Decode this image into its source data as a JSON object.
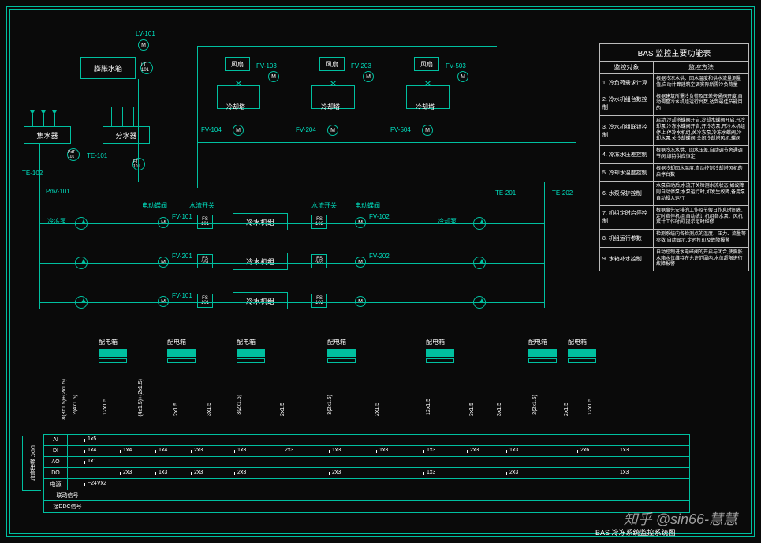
{
  "title_caption": "BAS 冷冻系统监控系统图",
  "watermark": "知乎 @sin66-慧慧",
  "tags": {
    "lv101": "LV-101",
    "lt101": "LT 101",
    "expansion_tank": "膨胀水箱",
    "collector": "集水器",
    "distributor": "分水器",
    "pdt101": "PdT 101",
    "te101": "TE-101",
    "te102": "TE-102",
    "ft101": "FT 101",
    "pdv101": "PdV-101",
    "te201": "TE-201",
    "te202": "TE-202",
    "fv103": "FV-103",
    "fv203": "FV-203",
    "fv503": "FV-503",
    "fv104": "FV-104",
    "fv204": "FV-204",
    "fv504": "FV-504",
    "fv101": "FV-101",
    "fv102": "FV-102",
    "fv201": "FV-201",
    "fv202": "FV-202",
    "fv301r": "FV-101",
    "fan": "风扇",
    "cooling_tower": "冷却塔",
    "chiller": "冷水机组",
    "freeze_pump_label": "冷冻泵",
    "cooling_pump_label": "冷却泵",
    "ddv_label_motor": "电动蝶阀",
    "ddv_label_flow": "水流开关",
    "fs101": "FS 101",
    "fs201": "FS 201",
    "fs301": "FS 101",
    "fs102": "FS 102",
    "fs202": "FS 202",
    "fs302": "FS 102",
    "m": "M",
    "dist_box": "配电箱"
  },
  "function_table": {
    "title": "BAS 监控主要功能表",
    "head1": "监控对象",
    "head2": "监控方法",
    "rows": [
      {
        "c1": "1. 冷负荷需求计算",
        "c2": "根据冷冻水供、回水温度和供水流量测量值,自动计算建筑空调实际所需冷负荷量"
      },
      {
        "c1": "2. 冷水机组台数控制",
        "c2": "根据建筑所需冷负荷及压差旁通阀开度,自动调整冷水机组运行台数,达到最佳节能目的"
      },
      {
        "c1": "3. 冷水机组联锁控制",
        "c2": "启动:冷却塔蝶阀开启,冷却水蝶阀开启,开冷却泵;冷冻水蝶阀开启,开冷冻泵,开冷水机组\n停止:停冷水机组,关冷冻泵,冷冻水蝶阀,冷却水泵,关冷却蝶阀,关闭冷却塔风机,蝶阀"
      },
      {
        "c1": "4. 冷冻水压差控制",
        "c2": "根据冷冻水供、回水压差,自动调节旁通调节阀,维持供应恒定"
      },
      {
        "c1": "5. 冷却水温度控制",
        "c2": "根据冷却回水温度,自动控制冷却塔风机的启停台数"
      },
      {
        "c1": "6. 水泵保护控制",
        "c2": "水泵启动后,水流开关检测水流状态,如故障则自动停泵;水泵运行时,如发生故障,备用泵自动投入运行"
      },
      {
        "c1": "7. 机组定时启停控制",
        "c2": "根据事先安排的工作及节假日作息时间表,定时启停机组;自动统计机组各水泵、风机累计工作时间,提示定时维修"
      },
      {
        "c1": "8. 机组运行参数",
        "c2": "检测系统内各检测点的温度、压力、流量等参数\n自动显示,定时打印及故障报警"
      },
      {
        "c1": "9. 水箱补水控制",
        "c2": "自动控制进水电磁阀的开启与闭合,使膨胀水箱水位维持在允许范围内,水位超限进行故障报警"
      }
    ]
  },
  "ddc": {
    "side": "DDC 输出信号",
    "rows": [
      {
        "label": "AI",
        "vals": [
          "1x5",
          "",
          "",
          "",
          "",
          "",
          "",
          "",
          ""
        ]
      },
      {
        "label": "DI",
        "vals": [
          "1x4",
          "1x4",
          "1x4",
          "2x3",
          "1x3",
          "2x3",
          "1x3",
          "1x3",
          "1x3",
          "2x3",
          "1x3",
          "",
          "2x6",
          "1x3"
        ]
      },
      {
        "label": "AO",
        "vals": [
          "1x1",
          "",
          "",
          "",
          "",
          "",
          "",
          "",
          "",
          "",
          "",
          "",
          "",
          ""
        ]
      },
      {
        "label": "DO",
        "vals": [
          "",
          "2x3",
          "1x3",
          "2x3",
          "2x3",
          "",
          "2x3",
          "",
          "1x3",
          "",
          "2x3",
          "",
          "",
          "1x3"
        ]
      },
      {
        "label": "电源",
        "vals": [
          "~24Vx2",
          "",
          "",
          "",
          "",
          "",
          "",
          "",
          "",
          "",
          "",
          "",
          "",
          ""
        ]
      }
    ],
    "extra1": "联动信号",
    "extra2": "接DDC信号"
  },
  "cables": {
    "c1": "8(3x1.5)+(2x1.5)",
    "c2": "2(4x1.5)",
    "c3": "12x1.5",
    "c4": "(4x1.5)+(2x1.5)",
    "c5": "2x1.5",
    "c6": "3x1.5",
    "c7": "3(2x1.5)",
    "c8": "2x1.5",
    "c9": "3(2x1.5)",
    "c10": "2x1.5",
    "c11": "12x1.5",
    "c12": "3x1.5",
    "c13": "3x1.5",
    "c14": "2(2x1.5)",
    "c15": "2x1.5",
    "c16": "12x1.5"
  },
  "dist_count_labels": [
    "配电箱",
    "配电箱",
    "配电箱",
    "配电箱",
    "配电箱",
    "配电箱",
    "配电箱"
  ]
}
